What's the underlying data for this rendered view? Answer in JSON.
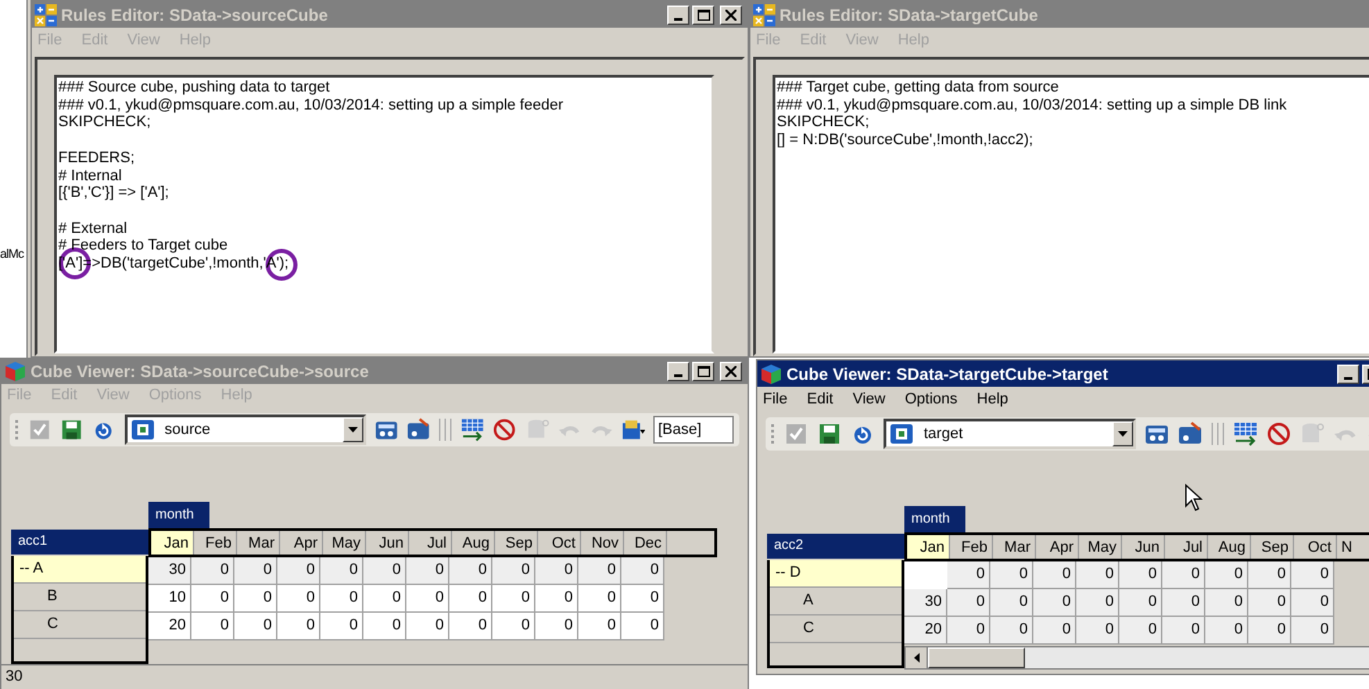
{
  "desktop_label": "alMc",
  "rules_editors": [
    {
      "title": "Rules Editor:  SData->sourceCube",
      "active": false,
      "menu": [
        "File",
        "Edit",
        "View",
        "Help"
      ],
      "text": "### Source cube, pushing data to target\n### v0.1, ykud@pmsquare.com.au, 10/03/2014: setting up a simple feeder\nSKIPCHECK;\n\nFEEDERS;\n# Internal\n[{'B','C'}] => ['A'];\n\n# External\n# Feeders to Target cube\n['A']=>DB('targetCube',!month,'A');",
      "annotated": true
    },
    {
      "title": "Rules Editor:  SData->targetCube",
      "active": false,
      "menu": [
        "File",
        "Edit",
        "View",
        "Help"
      ],
      "text": "### Target cube, getting data from source\n### v0.1, ykud@pmsquare.com.au, 10/03/2014: setting up a simple DB link\nSKIPCHECK;\n[] = N:DB('sourceCube',!month,!acc2);",
      "annotated": false
    }
  ],
  "cube_viewers": [
    {
      "title": "Cube Viewer: SData->sourceCube->source",
      "active": false,
      "menu": [
        "File",
        "Edit",
        "View",
        "Options",
        "Help"
      ],
      "view": "source",
      "subset": "[Base]",
      "column_dimension": "month",
      "row_dimension": "acc1",
      "rule_driven": false,
      "status": "30",
      "columns": [
        {
          "label": "Jan",
          "selected": true
        },
        {
          "label": "Feb",
          "selected": false
        },
        {
          "label": "Mar",
          "selected": false
        },
        {
          "label": "Apr",
          "selected": false
        },
        {
          "label": "May",
          "selected": false
        },
        {
          "label": "Jun",
          "selected": false
        },
        {
          "label": "Jul",
          "selected": false
        },
        {
          "label": "Aug",
          "selected": false
        },
        {
          "label": "Sep",
          "selected": false
        },
        {
          "label": "Oct",
          "selected": false
        },
        {
          "label": "Nov",
          "selected": false
        },
        {
          "label": "Dec",
          "selected": false
        }
      ],
      "rows": [
        {
          "label": "-- A",
          "selected": true,
          "values": [
            "30",
            "0",
            "0",
            "0",
            "0",
            "0",
            "0",
            "0",
            "0",
            "0",
            "0",
            "0"
          ],
          "children": [
            {
              "label": "B",
              "selected": false,
              "values": [
                "10",
                "0",
                "0",
                "0",
                "0",
                "0",
                "0",
                "0",
                "0",
                "0",
                "0",
                "0"
              ]
            },
            {
              "label": "C",
              "selected": false,
              "values": [
                "20",
                "0",
                "0",
                "0",
                "0",
                "0",
                "0",
                "0",
                "0",
                "0",
                "0",
                "0"
              ]
            }
          ]
        }
      ]
    },
    {
      "title": "Cube Viewer: SData->targetCube->target",
      "active": true,
      "menu": [
        "File",
        "Edit",
        "View",
        "Options",
        "Help"
      ],
      "view": "target",
      "column_dimension": "month",
      "row_dimension": "acc2",
      "rule_driven": true,
      "columns": [
        {
          "label": "Jan",
          "selected": true
        },
        {
          "label": "Feb",
          "selected": false
        },
        {
          "label": "Mar",
          "selected": false
        },
        {
          "label": "Apr",
          "selected": false
        },
        {
          "label": "May",
          "selected": false
        },
        {
          "label": "Jun",
          "selected": false
        },
        {
          "label": "Jul",
          "selected": false
        },
        {
          "label": "Aug",
          "selected": false
        },
        {
          "label": "Sep",
          "selected": false
        },
        {
          "label": "Oct",
          "selected": false
        },
        {
          "label": "N",
          "selected": false,
          "partial": true
        }
      ],
      "rows": [
        {
          "label": "-- D",
          "selected": true,
          "covered": true,
          "values": [
            "0",
            "0",
            "0",
            "0",
            "0",
            "0",
            "0",
            "0",
            "0"
          ],
          "children": [
            {
              "label": "A",
              "selected": false,
              "values": [
                "30",
                "0",
                "0",
                "0",
                "0",
                "0",
                "0",
                "0",
                "0",
                "0"
              ]
            },
            {
              "label": "C",
              "selected": false,
              "values": [
                "20",
                "0",
                "0",
                "0",
                "0",
                "0",
                "0",
                "0",
                "0",
                "0"
              ]
            }
          ]
        }
      ]
    }
  ]
}
